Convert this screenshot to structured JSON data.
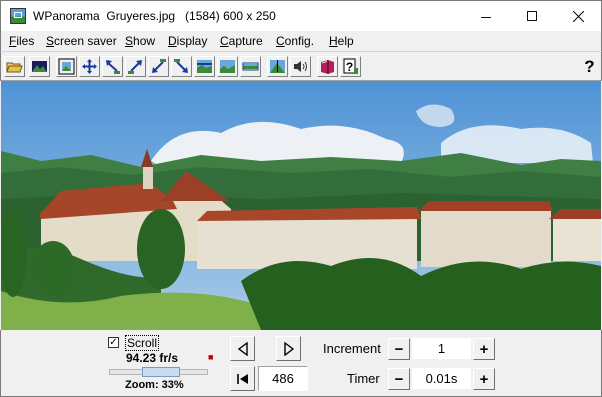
{
  "window": {
    "title": "WPanorama  Gruyeres.jpg   (1584) 600 x 250"
  },
  "menu": [
    {
      "label": "Files",
      "ul": "F",
      "rest": "iles"
    },
    {
      "label": "Screen saver",
      "ul": "S",
      "rest": "creen saver"
    },
    {
      "label": "Show",
      "ul": "S",
      "rest": "how"
    },
    {
      "label": "Display",
      "ul": "D",
      "rest": "isplay"
    },
    {
      "label": "Capture",
      "ul": "C",
      "rest": "apture"
    },
    {
      "label": "Config.",
      "ul": "C",
      "rest": "onfig."
    },
    {
      "label": "Help",
      "ul": "H",
      "rest": "elp"
    }
  ],
  "toolbar": {
    "help_label": "?"
  },
  "controls": {
    "scroll_checked": true,
    "scroll_check_glyph": "✓",
    "scroll_label": "Scroll",
    "fps": "94.23 fr/s",
    "zoom_label": "Zoom: 33%",
    "zoom_percent": 33,
    "position": "486",
    "increment_label": "Increment",
    "increment_value": "1",
    "timer_label": "Timer",
    "timer_value": "0.01s",
    "minus": "−",
    "plus": "+"
  },
  "colors": {
    "sky": "#6aa6dc",
    "hills": "#3c7a3c",
    "roofs": "#a8462a",
    "walls": "#e8e2d4"
  }
}
